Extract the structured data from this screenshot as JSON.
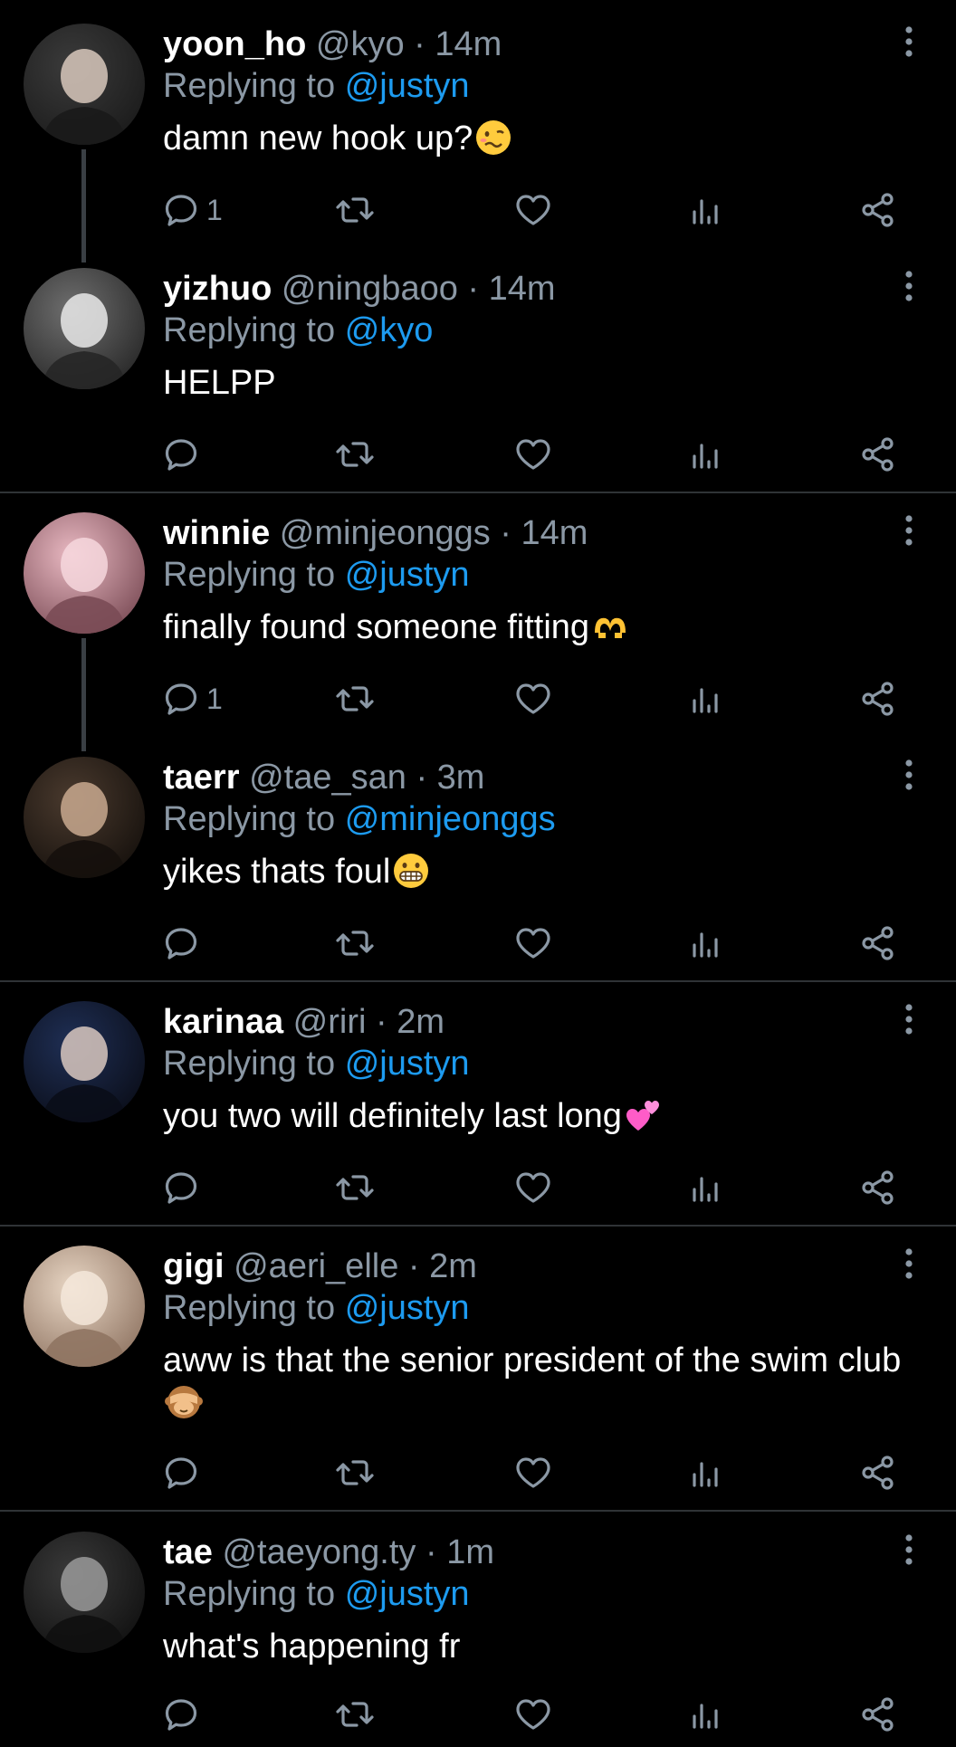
{
  "labels": {
    "replying_to": "Replying to"
  },
  "colors": {
    "background": "#000000",
    "text": "#ffffff",
    "muted": "#8b98a5",
    "mention": "#1d9bf0",
    "divider": "#2f3336"
  },
  "icons": {
    "reply": "speech-bubble-icon",
    "retweet": "retweet-icon",
    "like": "heart-icon",
    "views": "bar-chart-icon",
    "share": "share-icon",
    "more": "more-vertical-icon"
  },
  "tweets": [
    {
      "name": "yoon_ho",
      "handle": "@kyo",
      "sep": "·",
      "time": "14m",
      "replying_to": "@justyn",
      "text": "damn new hook up?",
      "emoji": "woozy-face",
      "reply_count": "1"
    },
    {
      "name": "yizhuo",
      "handle": "@ningbaoo",
      "sep": "·",
      "time": "14m",
      "replying_to": "@kyo",
      "text": "HELPP",
      "emoji": "",
      "reply_count": ""
    },
    {
      "name": "winnie",
      "handle": "@minjeonggs",
      "sep": "·",
      "time": "14m",
      "replying_to": "@justyn",
      "text": "finally found someone fitting",
      "emoji": "heart-hands",
      "reply_count": "1"
    },
    {
      "name": "taerr",
      "handle": "@tae_san",
      "sep": "·",
      "time": "3m",
      "replying_to": "@minjeonggs",
      "text": "yikes thats foul",
      "emoji": "grimacing-face",
      "reply_count": ""
    },
    {
      "name": "karinaa",
      "handle": "@riri",
      "sep": "·",
      "time": "2m",
      "replying_to": "@justyn",
      "text": "you two will definitely last long",
      "emoji": "two-hearts",
      "reply_count": ""
    },
    {
      "name": "gigi",
      "handle": "@aeri_elle",
      "sep": "·",
      "time": "2m",
      "replying_to": "@justyn",
      "text": "aww is that the senior president of the swim club",
      "emoji": "see-no-evil-monkey",
      "reply_count": ""
    },
    {
      "name": "tae",
      "handle": "@taeyong.ty",
      "sep": "·",
      "time": "1m",
      "replying_to": "@justyn",
      "text": "what's happening fr",
      "emoji": "",
      "reply_count": ""
    }
  ]
}
